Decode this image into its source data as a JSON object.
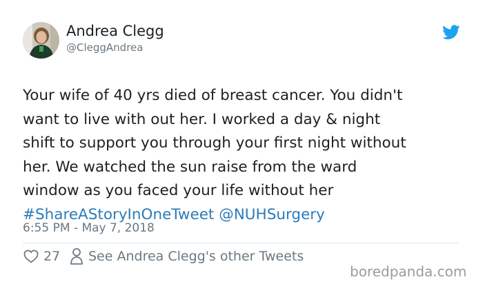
{
  "author": {
    "name": "Andrea Clegg",
    "handle": "@CleggAndrea"
  },
  "tweet": {
    "lines": [
      "Your wife of 40 yrs died of breast cancer. You didn't",
      "want to live with out her. I worked a day & night",
      "shift to support you through your first night without",
      "her. We watched the sun raise from the ward",
      "window as you faced your life without her"
    ],
    "hashtag": "#ShareAStoryInOneTweet",
    "mention": "@NUHSurgery",
    "timestamp": "6:55 PM - May 7, 2018"
  },
  "actions": {
    "like_count": "27",
    "see_other_label": "See Andrea Clegg's other Tweets"
  },
  "watermark": "boredpanda.com",
  "colors": {
    "link": "#2b7bb9",
    "twitter_blue": "#1da1f2",
    "secondary_text": "#697882"
  },
  "icons": {
    "brand": "twitter-bird-icon",
    "like": "heart-icon",
    "profile": "person-icon"
  }
}
